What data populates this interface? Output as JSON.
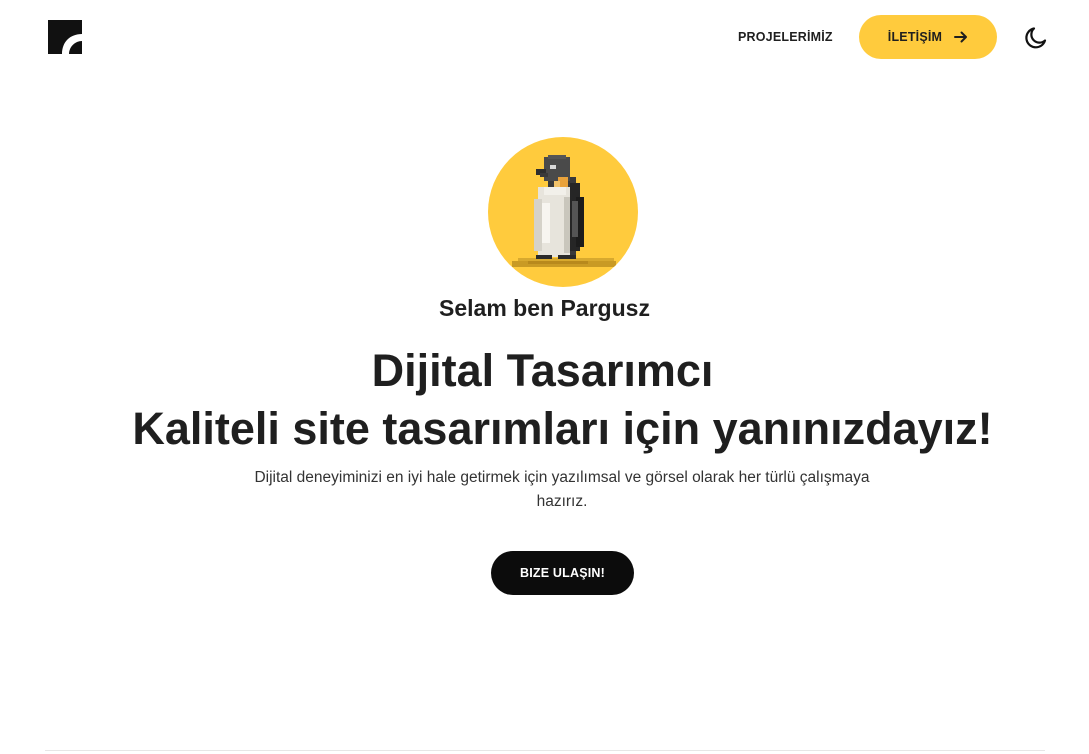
{
  "header": {
    "logo_icon": "brand-logo-icon",
    "nav": {
      "projects_label": "PROJELERİMİZ"
    },
    "contact_button": {
      "label": "İLETİŞİM",
      "icon": "arrow-right-icon"
    },
    "theme_toggle_icon": "moon-icon"
  },
  "hero": {
    "avatar_icon": "pixel-penguin-avatar",
    "greeting": "Selam ben Pargusz",
    "title_line_1": "Dijital Tasarımcı",
    "title_line_2": "Kaliteli site tasarımları için yanınızdayız!",
    "description": "Dijital deneyiminizi en iyi hale getirmek için yazılımsal ve görsel olarak her türlü çalışmaya hazırız.",
    "cta_label": "BIZE ULAŞIN!"
  },
  "colors": {
    "accent": "#ffcb3d",
    "text": "#1f1f1f",
    "cta_background": "#0c0c0c",
    "background": "#ffffff"
  }
}
